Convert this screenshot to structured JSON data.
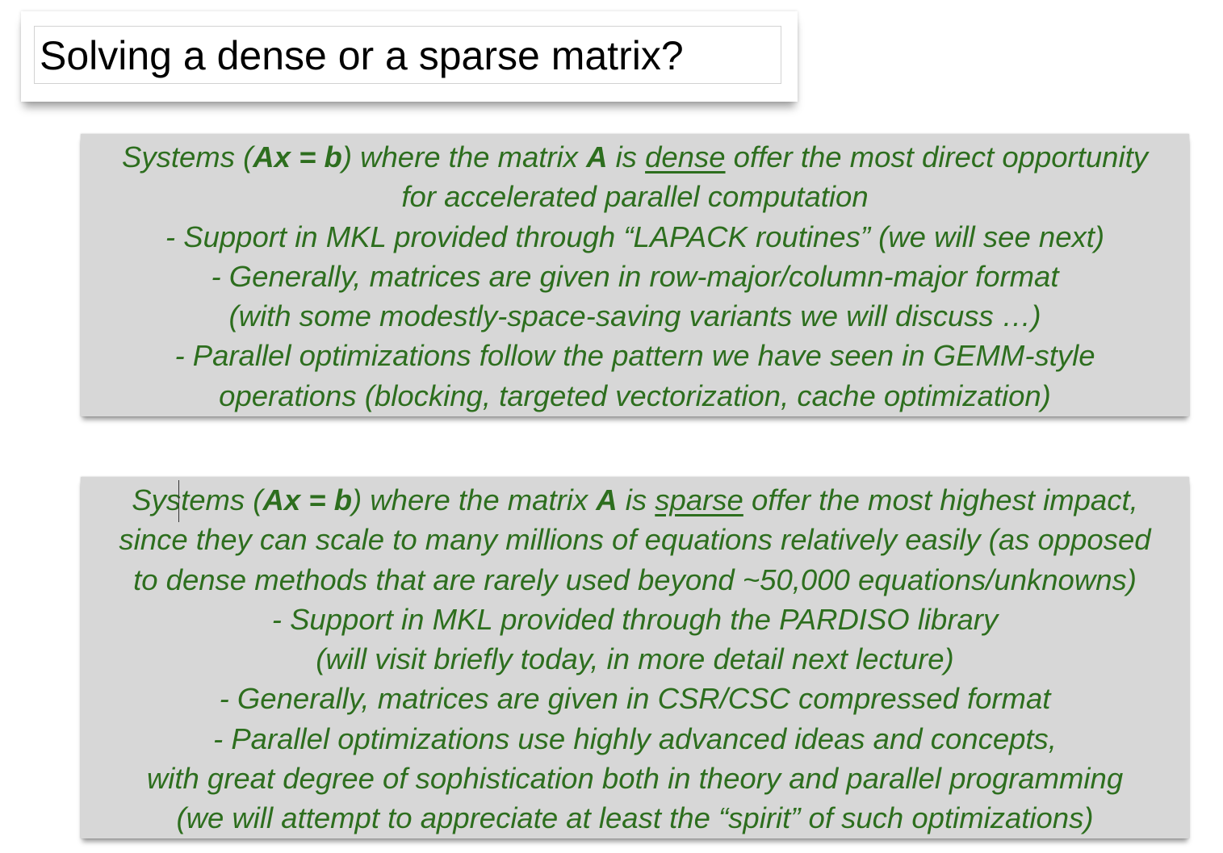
{
  "slide": {
    "title": "Solving a dense or a sparse matrix?",
    "dense_box": {
      "intro": {
        "t1": "Systems (",
        "eq": "Ax = b",
        "t2": ") where the matrix ",
        "matrix": "A",
        "t3": " is ",
        "keyword": "dense",
        "t4": " offer the most direct opportunity"
      },
      "lines": [
        "for accelerated parallel computation",
        "- Support in MKL provided through “LAPACK routines” (we will see next)",
        "- Generally, matrices are given in row-major/column-major format",
        "(with some modestly-space-saving variants we will discuss …)",
        "- Parallel optimizations follow the pattern we have seen in GEMM-style",
        "operations (blocking, targeted vectorization, cache optimization)"
      ]
    },
    "sparse_box": {
      "intro": {
        "t1": "Systems (",
        "eq": "Ax = b",
        "t2": ") where the matrix ",
        "matrix": "A",
        "t3": " is ",
        "keyword": "sparse",
        "t4": " offer the most highest impact,"
      },
      "lines": [
        "since they can scale to many millions of equations relatively easily (as opposed",
        "to dense methods that are rarely used beyond ~50,000 equations/unknowns)",
        "- Support in MKL provided through the PARDISO library",
        "(will visit briefly today, in more detail next lecture)",
        "- Generally, matrices are given in CSR/CSC compressed format",
        "- Parallel optimizations use highly advanced ideas and concepts,",
        "with great degree of sophistication both in theory and parallel programming",
        "(we will attempt to appreciate at least the “spirit” of such optimizations)"
      ]
    }
  }
}
